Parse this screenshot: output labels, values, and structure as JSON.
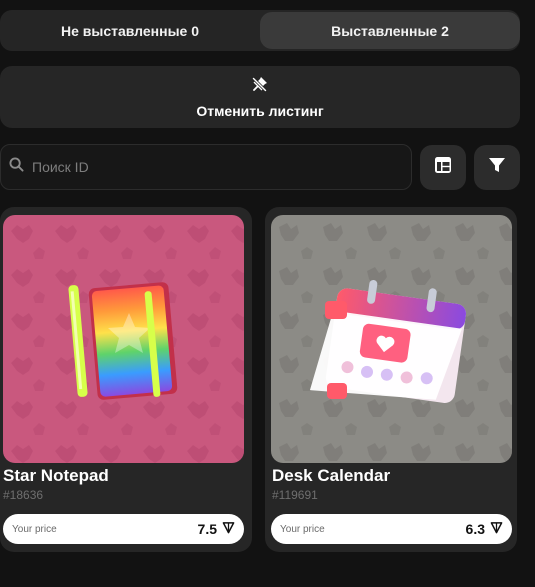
{
  "tabs": [
    {
      "label": "Не выставленные 0"
    },
    {
      "label": "Выставленные 2"
    }
  ],
  "cancel_listing": {
    "label": "Отменить листинг",
    "icon": "unpin-icon"
  },
  "search": {
    "placeholder": "Поиск ID",
    "value": ""
  },
  "toolbar": {
    "layout_icon": "table-layout-icon",
    "filter_icon": "filter-icon"
  },
  "cards": [
    {
      "name": "Star Notepad",
      "number": "#18636",
      "price_label": "Your price",
      "price": "7.5",
      "currency_icon": "ton-icon",
      "bg": "#c9587e"
    },
    {
      "name": "Desk Calendar",
      "number": "#119691",
      "price_label": "Your price",
      "price": "6.3",
      "currency_icon": "ton-icon",
      "bg": "#8c8b86"
    }
  ],
  "colors": {
    "background": "#121212",
    "panel": "#262626",
    "active_tab": "#3a3a3a"
  }
}
